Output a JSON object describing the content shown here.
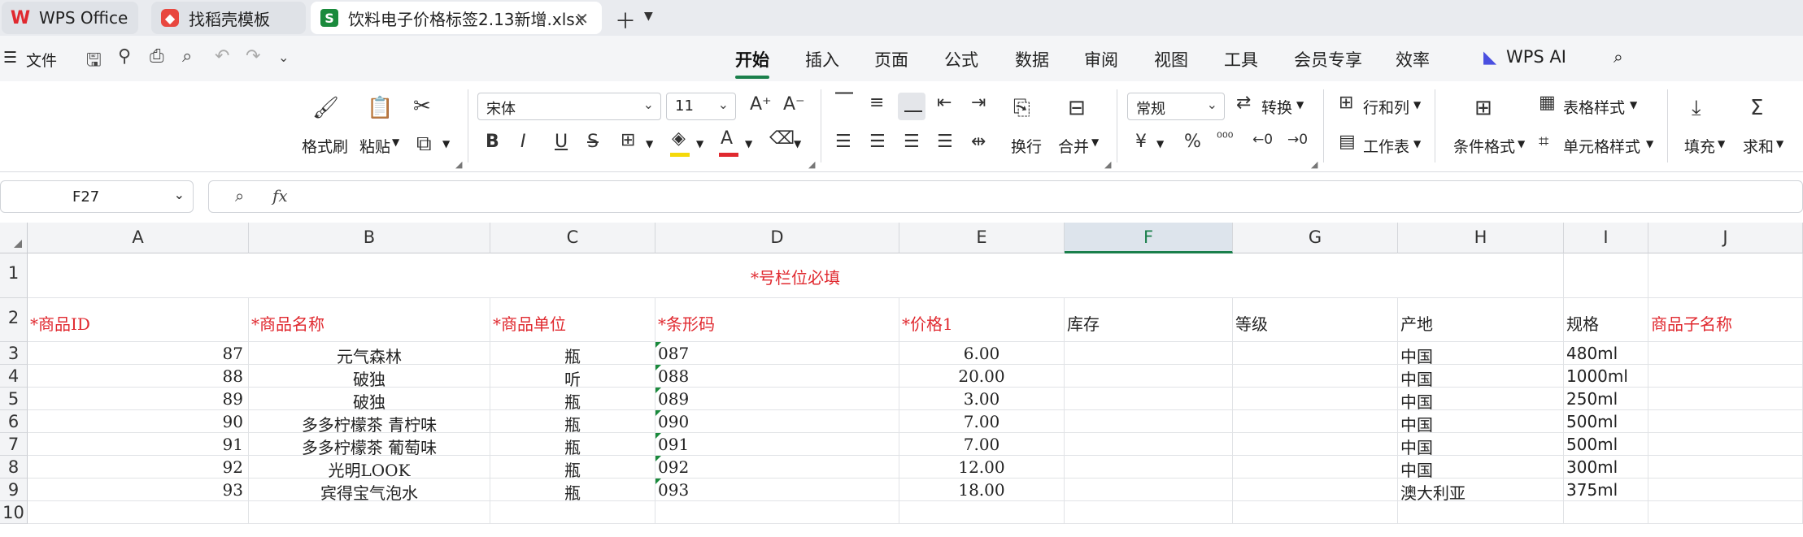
{
  "tabs": [
    {
      "label": "WPS Office",
      "icon": "wps-logo-icon"
    },
    {
      "label": "找稻壳模板",
      "icon": "docer-logo-icon"
    },
    {
      "label": "饮料电子价格标签2.13新增.xlsx",
      "icon": "spreadsheet-s-icon",
      "logo_text": "S"
    }
  ],
  "menubar": {
    "file_label": "文件",
    "tabs": [
      "开始",
      "插入",
      "页面",
      "公式",
      "数据",
      "审阅",
      "视图",
      "工具",
      "会员专享",
      "效率"
    ],
    "active_tab": "开始",
    "ai_label": "WPS AI"
  },
  "ribbon": {
    "format_painter": "格式刷",
    "paste": "粘贴",
    "font_name": "宋体",
    "font_size": "11",
    "wrap": "换行",
    "merge": "合并",
    "number_format": "常规",
    "convert": "转换",
    "rows_cols": "行和列",
    "worksheet": "工作表",
    "cond_format": "条件格式",
    "table_style": "表格样式",
    "cell_style": "单元格样式",
    "fill": "填充",
    "sum": "求和",
    "fill_color": "#f5d90a",
    "font_color": "#e0292f",
    "accent": "#1a7f4b"
  },
  "formula_bar": {
    "name_box": "F27",
    "fx": "fx",
    "value": ""
  },
  "grid": {
    "columns": [
      "A",
      "B",
      "C",
      "D",
      "E",
      "F",
      "G",
      "H",
      "I",
      "J"
    ],
    "selected_column": "F",
    "row_numbers": [
      "1",
      "2",
      "3",
      "4",
      "5",
      "6",
      "7",
      "8",
      "9",
      "10"
    ],
    "title": "*号栏位必填",
    "headers": [
      "*商品ID",
      "*商品名称",
      "*商品单位",
      "*条形码",
      "*价格1",
      "库存",
      "等级",
      "产地",
      "规格",
      "商品子名称"
    ],
    "rows": [
      [
        "87",
        "元气森林",
        "瓶",
        "087",
        "6.00",
        "",
        "",
        "中国",
        "480ml",
        ""
      ],
      [
        "88",
        "破独",
        "听",
        "088",
        "20.00",
        "",
        "",
        "中国",
        "1000ml",
        ""
      ],
      [
        "89",
        "破独",
        "瓶",
        "089",
        "3.00",
        "",
        "",
        "中国",
        "250ml",
        ""
      ],
      [
        "90",
        "多多柠檬茶 青柠味",
        "瓶",
        "090",
        "7.00",
        "",
        "",
        "中国",
        "500ml",
        ""
      ],
      [
        "91",
        "多多柠檬茶 葡萄味",
        "瓶",
        "091",
        "7.00",
        "",
        "",
        "中国",
        "500ml",
        ""
      ],
      [
        "92",
        "光明LOOK",
        "瓶",
        "092",
        "12.00",
        "",
        "",
        "中国",
        "300ml",
        ""
      ],
      [
        "93",
        "宾得宝气泡水",
        "瓶",
        "093",
        "18.00",
        "",
        "",
        "澳大利亚",
        "375ml",
        ""
      ]
    ],
    "header_color": "#e0292f"
  }
}
